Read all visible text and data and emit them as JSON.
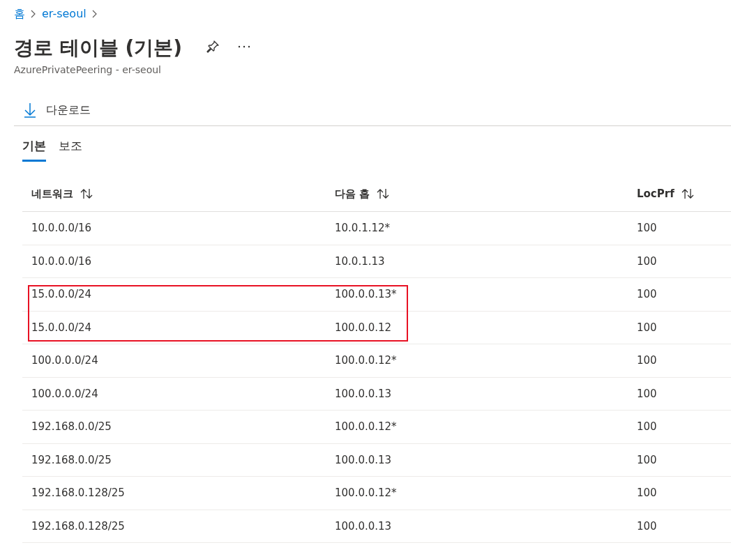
{
  "breadcrumb": [
    {
      "label": "홈"
    },
    {
      "label": "er-seoul"
    }
  ],
  "title": "경로 테이블 (기본)",
  "subtitle": "AzurePrivatePeering - er-seoul",
  "toolbar": [
    {
      "label": "다운로드"
    }
  ],
  "tabs": [
    {
      "label": "기본",
      "selected": true
    },
    {
      "label": "보조",
      "selected": false
    }
  ],
  "table": {
    "columns": [
      {
        "label": "네트워크"
      },
      {
        "label": "다음 홉"
      },
      {
        "label": "LocPrf"
      }
    ],
    "rows": [
      {
        "cells": [
          "10.0.0.0/16",
          "10.0.1.12*",
          "100"
        ],
        "highlighted": false
      },
      {
        "cells": [
          "10.0.0.0/16",
          "10.0.1.13",
          "100"
        ],
        "highlighted": false
      },
      {
        "cells": [
          "15.0.0.0/24",
          "100.0.0.13*",
          "100"
        ],
        "highlighted": true
      },
      {
        "cells": [
          "15.0.0.0/24",
          "100.0.0.12",
          "100"
        ],
        "highlighted": true
      },
      {
        "cells": [
          "100.0.0.0/24",
          "100.0.0.12*",
          "100"
        ],
        "highlighted": false
      },
      {
        "cells": [
          "100.0.0.0/24",
          "100.0.0.13",
          "100"
        ],
        "highlighted": false
      },
      {
        "cells": [
          "192.168.0.0/25",
          "100.0.0.12*",
          "100"
        ],
        "highlighted": false
      },
      {
        "cells": [
          "192.168.0.0/25",
          "100.0.0.13",
          "100"
        ],
        "highlighted": false
      },
      {
        "cells": [
          "192.168.0.128/25",
          "100.0.0.12*",
          "100"
        ],
        "highlighted": false
      },
      {
        "cells": [
          "192.168.0.128/25",
          "100.0.0.13",
          "100"
        ],
        "highlighted": false
      }
    ]
  }
}
